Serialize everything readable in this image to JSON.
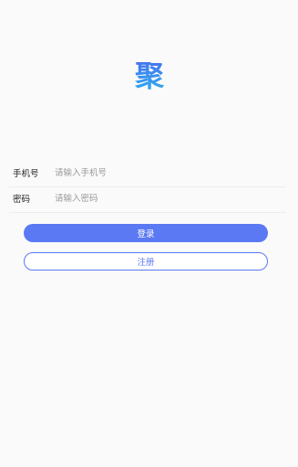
{
  "logo": {
    "char": "聚",
    "gradient_colors": [
      "#4a6cf0",
      "#2fb0ec"
    ]
  },
  "form": {
    "phone": {
      "label": "手机号",
      "placeholder": "请输入手机号",
      "value": ""
    },
    "password": {
      "label": "密码",
      "placeholder": "请输入密码",
      "value": ""
    }
  },
  "buttons": {
    "login_label": "登录",
    "register_label": "注册"
  },
  "colors": {
    "accent": "#5b79f2",
    "background": "#fafafa"
  }
}
